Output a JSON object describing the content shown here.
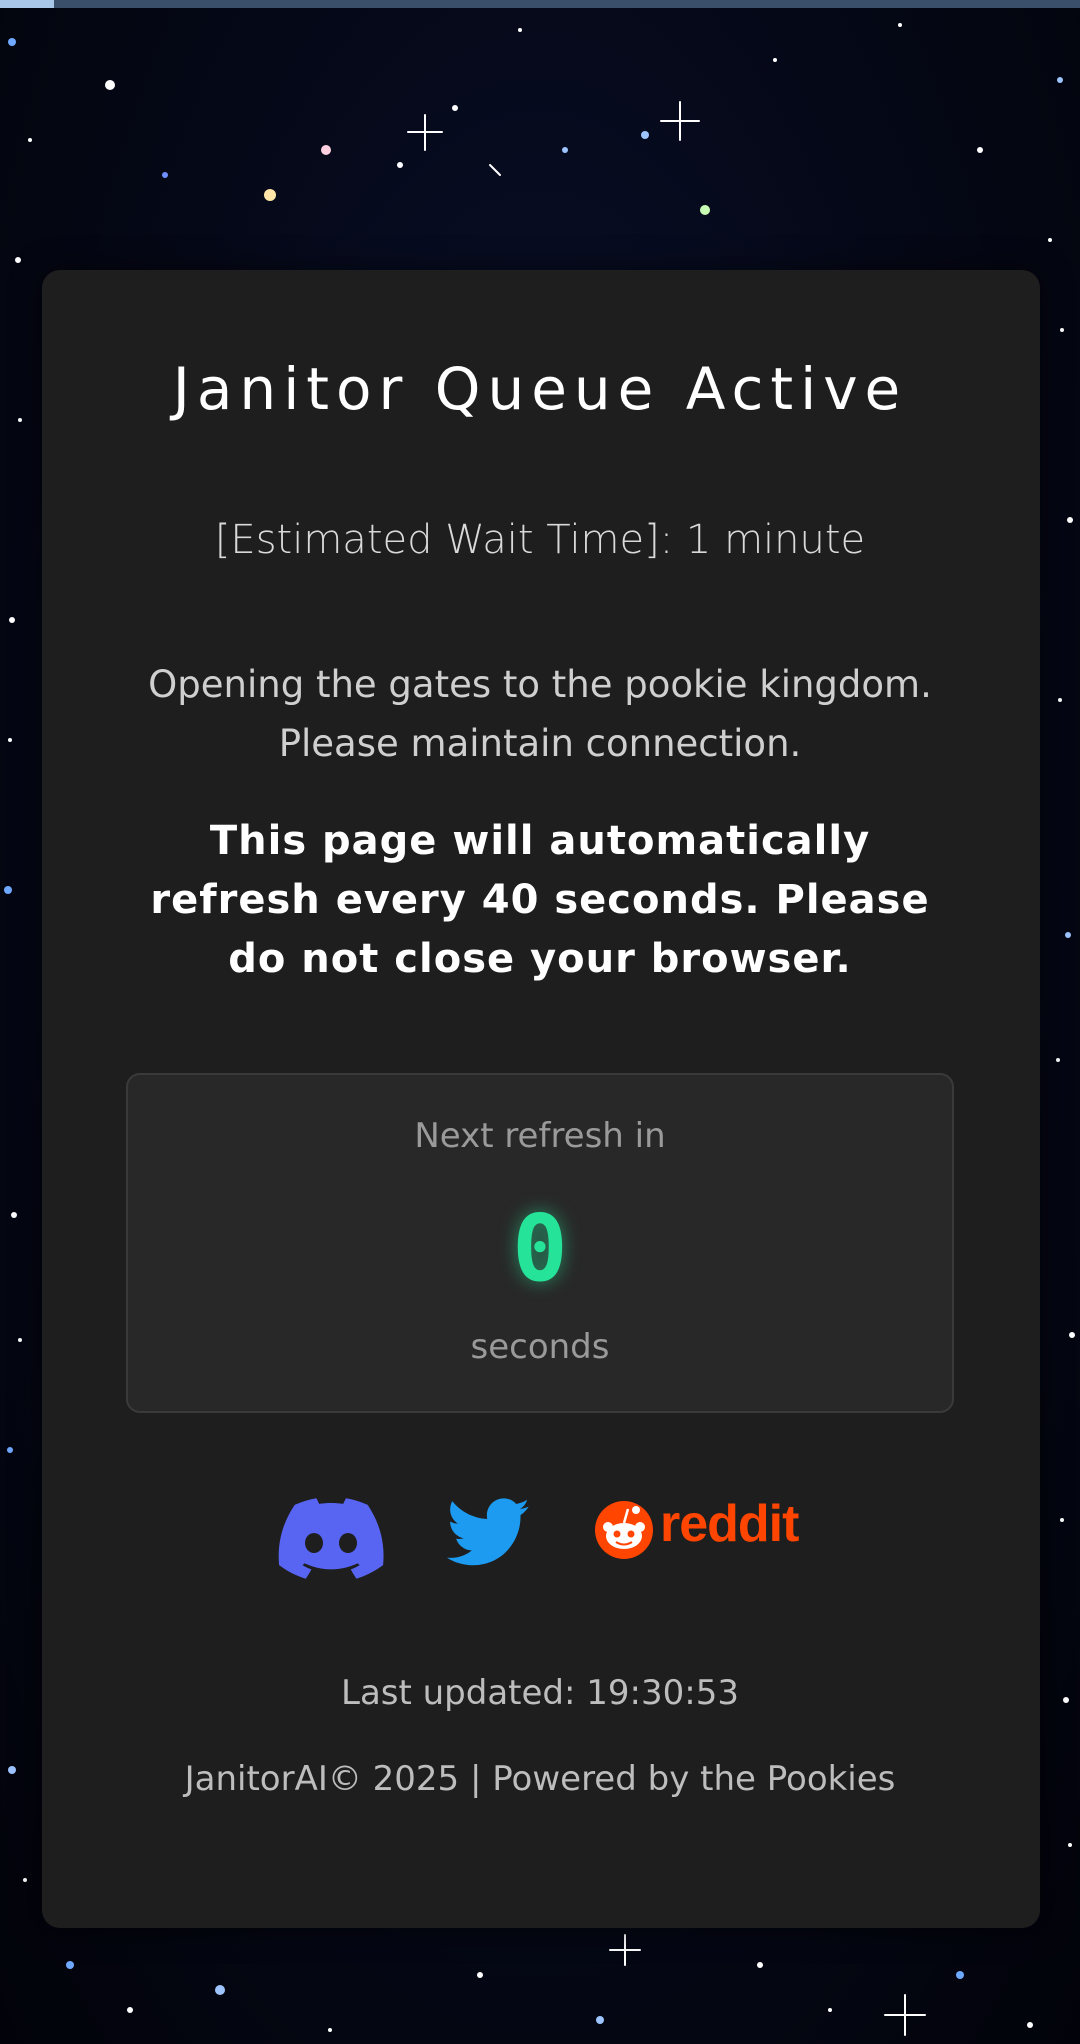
{
  "loading_bar": {
    "progress": 0.05,
    "color": "#a9c7e8"
  },
  "queue": {
    "title": "Janitor Queue Active",
    "wait_time": "[Estimated Wait Time]: 1 minute",
    "message_line1": "Opening the gates to the pookie kingdom.",
    "message_line2": "Please maintain connection.",
    "refresh_notice": "This page will automatically refresh every 40 seconds. Please do not close your browser."
  },
  "countdown": {
    "label": "Next refresh in",
    "value": "0",
    "unit": "seconds",
    "accent_color": "#26e39a"
  },
  "social": {
    "discord_icon": "discord-icon",
    "twitter_icon": "twitter-icon",
    "reddit_icon": "reddit-icon",
    "reddit_label": "reddit",
    "colors": {
      "discord": "#5865f2",
      "twitter": "#1d9bf0",
      "reddit": "#ff4500"
    }
  },
  "status": {
    "last_updated": "Last updated: 19:30:53"
  },
  "footer": {
    "text": "JanitorAI© 2025 | Powered by the Pookies"
  }
}
